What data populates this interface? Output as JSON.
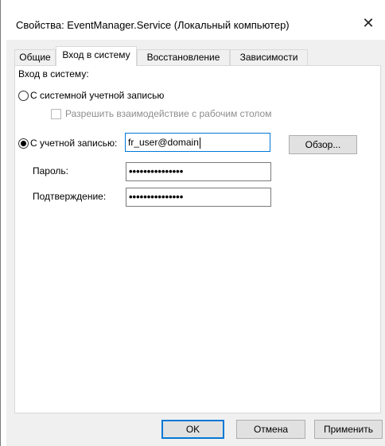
{
  "window": {
    "title": "Свойства: EventManager.Service (Локальный компьютер)",
    "close_glyph": "✕"
  },
  "tabs": [
    {
      "label": "Общие",
      "active": false
    },
    {
      "label": "Вход в систему",
      "active": true
    },
    {
      "label": "Восстановление",
      "active": false
    },
    {
      "label": "Зависимости",
      "active": false
    }
  ],
  "logon": {
    "group_label": "Вход в систему:",
    "system_account_label": "С системной учетной записью",
    "system_account_selected": false,
    "desktop_interact_label": "Разрешить взаимодействие с рабочим столом",
    "desktop_interact_checked": false,
    "this_account_label": "С учетной записью:",
    "this_account_selected": true,
    "account_value": "fr_user@domain",
    "browse_label": "Обзор...",
    "password_label": "Пароль:",
    "password_value": "•••••••••••••••",
    "confirm_label": "Подтверждение:",
    "confirm_value": "•••••••••••••••"
  },
  "buttons": {
    "ok": "OK",
    "cancel": "Отмена",
    "apply": "Применить"
  },
  "colors": {
    "dialog_bg": "#f0f0f0",
    "focus_border": "#0078d7"
  }
}
